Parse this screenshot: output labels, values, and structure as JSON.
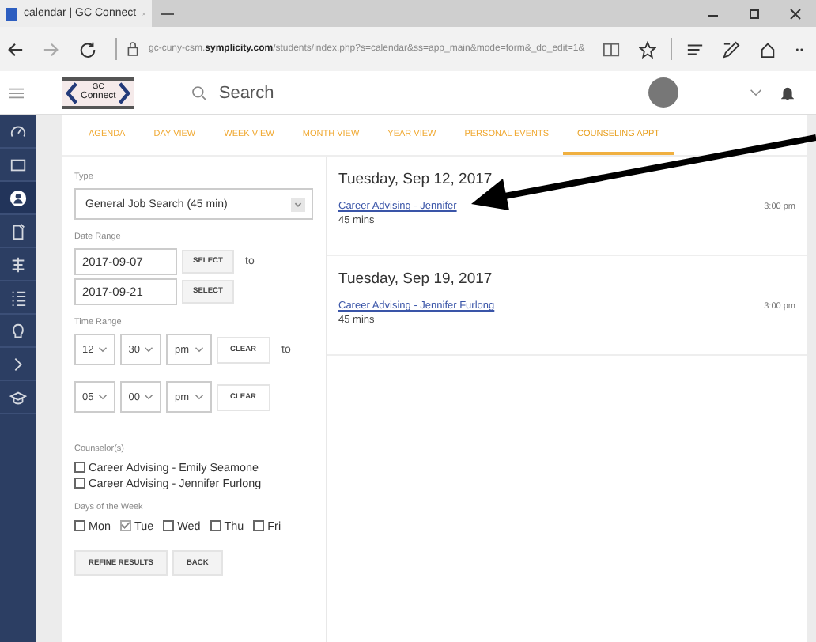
{
  "browser": {
    "tab_title": "calendar | GC Connect",
    "url": "gc-cuny-csm.**symplicity.com**/students/index.php?s=calendar&ss=app_main&mode=form&_do_edit=1&"
  },
  "header": {
    "logo_top": "GC",
    "logo_bottom": "Connect",
    "search_placeholder": "Search"
  },
  "sidebar": {
    "items": [
      {
        "selected": false,
        "kind": "gauge"
      },
      {
        "selected": false,
        "kind": "calendar"
      },
      {
        "selected": true,
        "kind": "person"
      },
      {
        "selected": false,
        "kind": "doc"
      },
      {
        "selected": false,
        "kind": "sign"
      },
      {
        "selected": false,
        "kind": "list"
      },
      {
        "selected": false,
        "kind": "bulb"
      },
      {
        "selected": false,
        "kind": "chevron"
      },
      {
        "selected": false,
        "kind": "cap"
      }
    ]
  },
  "tabs": [
    {
      "label": "AGENDA",
      "selected": false
    },
    {
      "label": "DAY VIEW",
      "selected": false
    },
    {
      "label": "WEEK VIEW",
      "selected": false
    },
    {
      "label": "MONTH VIEW",
      "selected": false
    },
    {
      "label": "YEAR VIEW",
      "selected": false
    },
    {
      "label": "PERSONAL EVENTS",
      "selected": false
    },
    {
      "label": "COUNSELING APPT",
      "selected": true
    }
  ],
  "form": {
    "type_label": "Type",
    "type_value": "General Job Search (45 min)",
    "date_label": "Date Range",
    "dates": [
      {
        "value": "2017-09-07",
        "button": "SELECT",
        "suffix": "to"
      },
      {
        "value": "2017-09-21",
        "button": "SELECT"
      }
    ],
    "time_label": "Time Range",
    "times": [
      {
        "hour": "12",
        "minute": "30",
        "ampm": "pm",
        "button": "CLEAR",
        "suffix": "to"
      },
      {
        "hour": "05",
        "minute": "00",
        "ampm": "pm",
        "button": "CLEAR"
      }
    ],
    "counselor_label": "Counselor(s)",
    "counselors": [
      {
        "label": "Career Advising - Emily Seamone",
        "checked": false
      },
      {
        "label": "Career Advising - Jennifer Furlong",
        "checked": false
      }
    ],
    "days_label": "Days of the Week",
    "days": [
      {
        "label": "Mon",
        "checked": false
      },
      {
        "label": "Tue",
        "checked": true
      },
      {
        "label": "Wed",
        "checked": false
      },
      {
        "label": "Thu",
        "checked": false
      },
      {
        "label": "Fri",
        "checked": false
      }
    ],
    "buttons": [
      "REFINE RESULTS",
      "BACK"
    ]
  },
  "events": [
    {
      "date": "Tuesday, Sep 12, 2017",
      "link": "Career Advising - Jennifer",
      "time": "3:00 pm",
      "duration": "45 mins"
    },
    {
      "date": "Tuesday, Sep 19, 2017",
      "link": "Career Advising - Jennifer Furlong",
      "time": "3:00 pm",
      "duration": "45 mins"
    }
  ]
}
